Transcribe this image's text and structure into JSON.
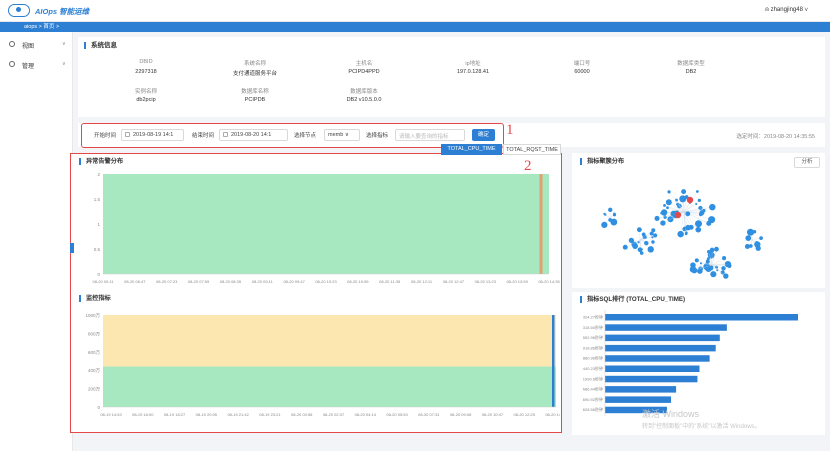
{
  "app": {
    "brand": "AIOps 智能运维",
    "user": "zhangjing48"
  },
  "breadcrumb": "aiops > 首页 >",
  "sidebar": {
    "items": [
      {
        "label": "视图"
      },
      {
        "label": "管理"
      }
    ]
  },
  "system_info": {
    "title": "系统信息",
    "row1": [
      {
        "key": "DBID",
        "value": "2297318"
      },
      {
        "key": "系统名称",
        "value": "支付通道服务平台"
      },
      {
        "key": "主机名",
        "value": "PCIPD4PPD"
      },
      {
        "key": "ip地址",
        "value": "197.0.128.41"
      },
      {
        "key": "端口号",
        "value": "60000"
      },
      {
        "key": "数据库类型",
        "value": "DB2"
      }
    ],
    "row2": [
      {
        "key": "实例名称",
        "value": "db2pcip"
      },
      {
        "key": "数据库名称",
        "value": "PCIPDB"
      },
      {
        "key": "数据库版本",
        "value": "DB2 v10.5.0.0"
      }
    ]
  },
  "filter": {
    "start_label": "开始时间",
    "start_value": "2019-08-19 14:1",
    "end_label": "结束时间",
    "end_value": "2019-08-20 14:1",
    "node_label": "选择节点",
    "node_value": "memb",
    "metric_label": "选择指标",
    "metric_placeholder": "请输入要查询的指标",
    "confirm_label": "确定",
    "selected_time": "选定时间：2019-08-20 14:35:55"
  },
  "annotations": {
    "box1": "1",
    "box2": "2"
  },
  "panels": {
    "anomaly_title": "异常告警分布",
    "monitor_title": "监控指标",
    "cluster_title": "指标聚簇分布",
    "analyze_label": "分析",
    "sql_rank_title": "指标SQL排行 (TOTAL_CPU_TIME)"
  },
  "tabs": [
    {
      "label": "TOTAL_CPU_TIME",
      "active": true
    },
    {
      "label": "TOTAL_RQST_TIME",
      "active": false
    }
  ],
  "watermark": {
    "line1": "激活 Windows",
    "line2": "转到\"控制面板\"中的\"系统\"以激活 Windows。"
  },
  "colors": {
    "accent": "#2d7fd3",
    "highlight": "#e54848",
    "green_band": "#a7e8c0",
    "yellow_band": "#fde7b0",
    "bar": "#2d7fd3"
  },
  "chart_data": [
    {
      "type": "area",
      "title": "异常告警分布",
      "ylim": [
        0,
        2
      ],
      "yticks": [
        "0",
        "0.5",
        "1",
        "1.5",
        "2"
      ],
      "x": [
        "08-20 00:11",
        "08-20 06:47",
        "08-20 07:23",
        "08-20 07:59",
        "08-20 08:35",
        "08-20 09:11",
        "08-20 09:47",
        "08-20 10:23",
        "08-20 10:59",
        "08-20 11:35",
        "08-20 12:11",
        "08-20 12:47",
        "08-20 13:23",
        "08-20 13:59",
        "08-20 14:35"
      ],
      "series": [
        {
          "values": [
            0,
            0,
            0,
            0,
            0,
            0,
            0,
            0,
            0,
            0,
            0,
            0,
            0,
            0,
            2
          ]
        }
      ],
      "band": "normal range 0-2 (green)"
    },
    {
      "type": "line",
      "title": "监控指标",
      "yticks": [
        "0",
        "200万",
        "400万",
        "600万",
        "800万",
        "1000万"
      ],
      "x": [
        "08-19 14:53",
        "08-19 16:00",
        "08-19 18:27",
        "08-19 20:05",
        "08-19 21:42",
        "08-19 23:21",
        "08-20 00:58",
        "08-20 02:37",
        "08-20 04:14",
        "08-20 05:53",
        "08-20 07:31",
        "08-20 09:08",
        "08-20 10:47",
        "08-20 12:25",
        "08-20 14:03"
      ],
      "series": [
        {
          "values": [
            0,
            0,
            0,
            0,
            0,
            0,
            0,
            0,
            0,
            0,
            0,
            0,
            0,
            0,
            1000
          ]
        }
      ]
    },
    {
      "type": "bar",
      "title": "指标SQL排行 (TOTAL_CPU_TIME)",
      "orientation": "horizontal",
      "categories": [
        "324.27秒钟",
        "318.50秒钟",
        "552.96秒钟",
        "918.86秒钟",
        "880.96秒钟",
        "440.23秒钟",
        "1990.6秒钟",
        "686.44秒钟",
        "690.92秒钟",
        "628.56秒钟"
      ],
      "values": [
        190,
        120,
        113,
        109,
        103,
        93,
        91,
        70,
        65,
        61
      ]
    }
  ]
}
